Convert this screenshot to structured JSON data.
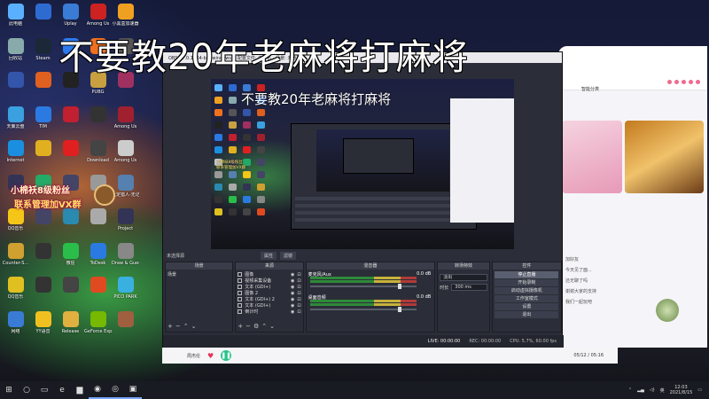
{
  "overlay": {
    "title": "不要教20年老麻将打麻将"
  },
  "desktop": {
    "icons": [
      {
        "label": "此电脑",
        "icon": "computer-icon",
        "color": "#5ab0ff"
      },
      {
        "label": "",
        "icon": "app-icon",
        "color": "#2e6bd1"
      },
      {
        "label": "Uplay",
        "icon": "uplay-icon",
        "color": "#3a7bd5"
      },
      {
        "label": "Among Us",
        "icon": "amongus-icon",
        "color": "#c22"
      },
      {
        "label": "小黑盒加速器",
        "icon": "heybox-icon",
        "color": "#f0a020"
      },
      {
        "label": "回收站",
        "icon": "recycle-bin-icon",
        "color": "#8aa"
      },
      {
        "label": "Steam",
        "icon": "steam-icon",
        "color": "#1b2838"
      },
      {
        "label": "",
        "icon": "k-icon",
        "color": "#2b7bef"
      },
      {
        "label": "",
        "icon": "app-icon",
        "color": "#f07020"
      },
      {
        "label": "",
        "icon": "app-icon",
        "color": "#555"
      },
      {
        "label": "",
        "icon": "app-icon",
        "color": "#3355aa"
      },
      {
        "label": "",
        "icon": "app-icon",
        "color": "#e06020"
      },
      {
        "label": "",
        "icon": "app-icon",
        "color": "#222"
      },
      {
        "label": "PUBG",
        "icon": "pubg-icon",
        "color": "#c8a040"
      },
      {
        "label": "",
        "icon": "app-icon",
        "color": "#a03060"
      },
      {
        "label": "天翼云盘",
        "icon": "cloud-icon",
        "color": "#3aa0e0"
      },
      {
        "label": "TIM",
        "icon": "tim-icon",
        "color": "#2a7ae2"
      },
      {
        "label": "",
        "icon": "app-icon",
        "color": "#c02030"
      },
      {
        "label": "",
        "icon": "app-icon",
        "color": "#333"
      },
      {
        "label": "Among Us",
        "icon": "amongus-icon",
        "color": "#a02030"
      },
      {
        "label": "Internet",
        "icon": "ie-icon",
        "color": "#1a8fe0"
      },
      {
        "label": "",
        "icon": "chrome-icon",
        "color": "#e0b020"
      },
      {
        "label": "",
        "icon": "youtube-icon",
        "color": "#e02020"
      },
      {
        "label": "Download",
        "icon": "download-icon",
        "color": "#444"
      },
      {
        "label": "Among Us",
        "icon": "amongus-icon",
        "color": "#ccc"
      },
      {
        "label": "",
        "icon": "app-icon",
        "color": "#335"
      },
      {
        "label": "",
        "icon": "app-icon",
        "color": "#2a6"
      },
      {
        "label": "",
        "icon": "app-icon",
        "color": "#446"
      },
      {
        "label": "",
        "icon": "app-icon",
        "color": "#999"
      },
      {
        "label": "大定猎人-无记",
        "icon": "app-icon",
        "color": "#5580b0"
      },
      {
        "label": "QQ音乐",
        "icon": "qqmusic-icon",
        "color": "#f5c518"
      },
      {
        "label": "",
        "icon": "app-icon",
        "color": "#446"
      },
      {
        "label": "",
        "icon": "app-icon",
        "color": "#2a8ab0"
      },
      {
        "label": "",
        "icon": "app-icon",
        "color": "#aaa"
      },
      {
        "label": "Project",
        "icon": "app-icon",
        "color": "#335"
      },
      {
        "label": "Counter-S...",
        "icon": "csgo-icon",
        "color": "#d0a030"
      },
      {
        "label": "",
        "icon": "app-icon",
        "color": "#333"
      },
      {
        "label": "微信",
        "icon": "wechat-icon",
        "color": "#2bbd4a"
      },
      {
        "label": "ToDesk",
        "icon": "todesk-icon",
        "color": "#2a7ae2"
      },
      {
        "label": "Draw & Guess",
        "icon": "draw-icon",
        "color": "#888"
      },
      {
        "label": "QQ音乐",
        "icon": "qqmusic-icon",
        "color": "#e0c020"
      },
      {
        "label": "",
        "icon": "app-icon",
        "color": "#333"
      },
      {
        "label": "",
        "icon": "app-icon",
        "color": "#444"
      },
      {
        "label": "",
        "icon": "app-icon",
        "color": "#e04a20"
      },
      {
        "label": "PICO PARK",
        "icon": "picopark-icon",
        "color": "#3ab0e0"
      },
      {
        "label": "网络",
        "icon": "network-icon",
        "color": "#3a7bd5"
      },
      {
        "label": "YY语音",
        "icon": "yy-icon",
        "color": "#f0c020"
      },
      {
        "label": "Release",
        "icon": "folder-icon",
        "color": "#e0b040"
      },
      {
        "label": "GeForce Experience",
        "icon": "geforce-icon",
        "color": "#76b900"
      },
      {
        "label": "",
        "icon": "app-icon",
        "color": "#a06040"
      }
    ],
    "fan_banner": {
      "line1": "小棉袄8级粉丝",
      "line2": "联系管理加VX群"
    }
  },
  "obs": {
    "window_title": "OBS 27.0.1 (64-bit, windows) - 配置文件: 未命名 - 场景: 未命名",
    "nested_title": "不要教20年老麻将打麻将",
    "nested_subtitle": "不要教20年老麻将打麻将",
    "scene_label": "未选择源",
    "ctrl_tabs": [
      "属性",
      "滤镜"
    ],
    "docks": {
      "scenes": {
        "header": "场景",
        "items": [
          "场景"
        ]
      },
      "sources": {
        "header": "来源",
        "items": [
          "图像",
          "视频采集设备",
          "文本 (GDI+)",
          "图像 2",
          "文本 (GDI+) 2",
          "文本 (GDI+)",
          "倒计时"
        ]
      },
      "mixer": {
        "header": "混音器",
        "channels": [
          {
            "name": "麦克风/Aux",
            "value": "0.0 dB"
          },
          {
            "name": "桌面音频",
            "value": "0.0 dB"
          }
        ]
      },
      "transitions": {
        "header": "转场特效",
        "type": "淡出",
        "duration_label": "时长",
        "duration": "300 ms"
      },
      "controls": {
        "header": "控件",
        "buttons": [
          "停止直播",
          "开始录制",
          "启动虚拟摄像机",
          "工作室模式",
          "设置",
          "退出"
        ]
      }
    },
    "status": {
      "live": "LIVE: 00:00:00",
      "rec": "REC: 00:00:00",
      "cpu": "CPU: 5.7%, 60.00 fps"
    }
  },
  "chat": {
    "category": "智能分类",
    "messages": [
      "加好友",
      "今天见了面...",
      "还无聊了吗",
      "谢谢大家的支持",
      "我们一起玩吧"
    ]
  },
  "chatbar": {
    "user": "周杰伦",
    "time": "05/12 / 05:16"
  },
  "taskbar": {
    "items": [
      {
        "icon": "windows-start-icon",
        "glyph": "⊞"
      },
      {
        "icon": "search-icon",
        "glyph": "○"
      },
      {
        "icon": "task-view-icon",
        "glyph": "▭"
      },
      {
        "icon": "edge-icon",
        "glyph": "e"
      },
      {
        "icon": "file-explorer-icon",
        "glyph": "▆"
      },
      {
        "icon": "wechat-icon",
        "glyph": "◉"
      },
      {
        "icon": "obs-icon",
        "glyph": "◎"
      },
      {
        "icon": "app-icon",
        "glyph": "▣"
      }
    ],
    "time": "12:03",
    "date": "2021/8/15"
  }
}
